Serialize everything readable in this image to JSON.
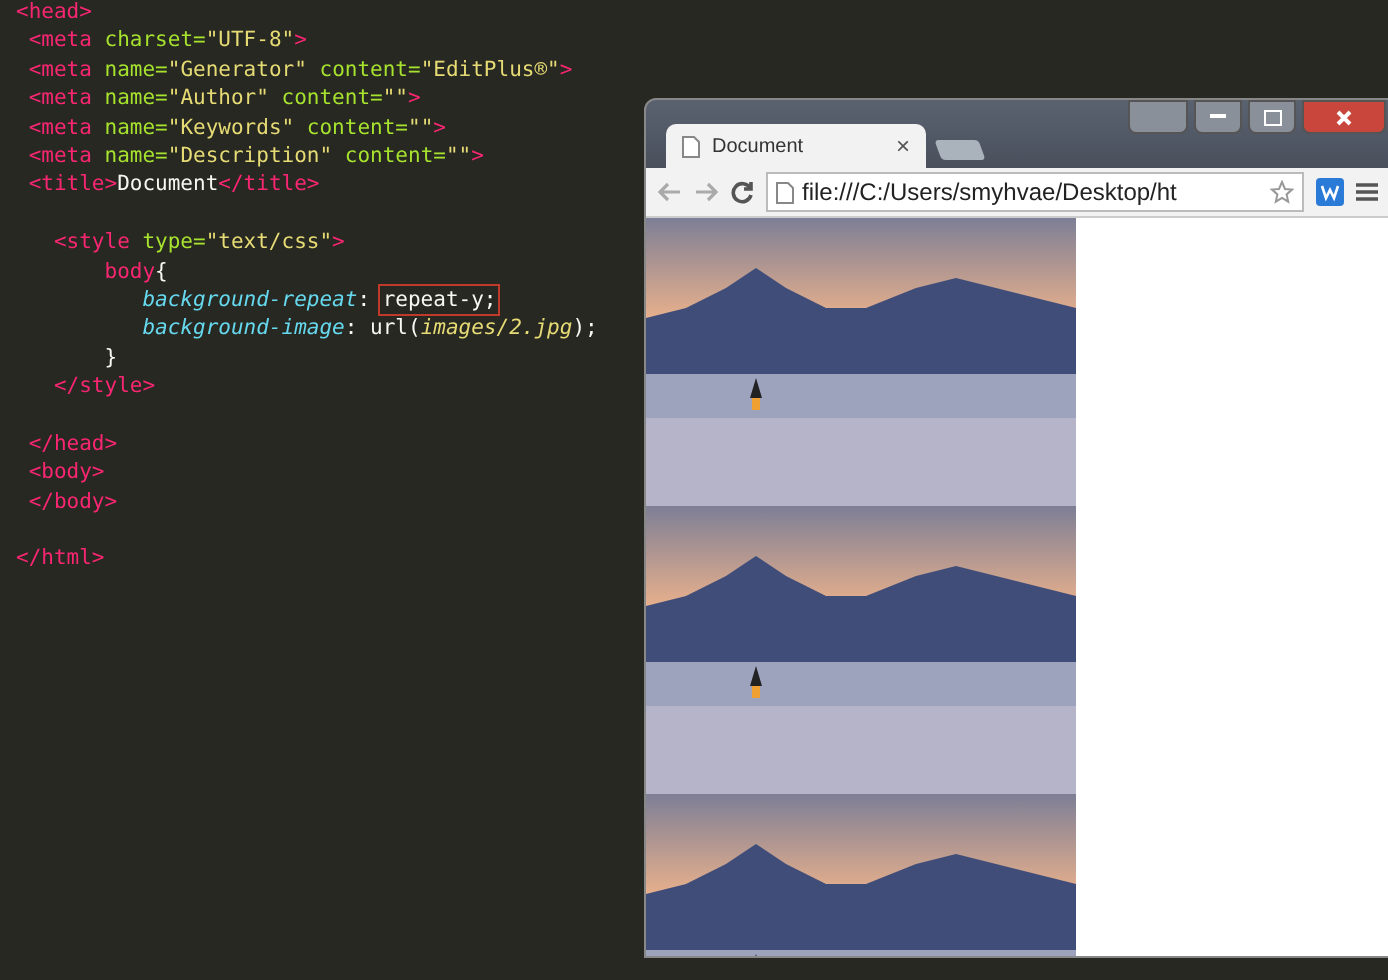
{
  "editor": {
    "lines": [
      {
        "space_after": false,
        "tokens": [
          {
            "kind": "tag",
            "text": "<head>"
          }
        ]
      },
      {
        "space_after": false,
        "tokens": [
          {
            "kind": "tag",
            "text": " <meta "
          },
          {
            "kind": "attr",
            "text": "charset="
          },
          {
            "kind": "string",
            "text": "\"UTF-8\""
          },
          {
            "kind": "tag",
            "text": ">"
          }
        ]
      },
      {
        "space_after": false,
        "tokens": [
          {
            "kind": "tag",
            "text": " <meta "
          },
          {
            "kind": "attr",
            "text": "name="
          },
          {
            "kind": "string",
            "text": "\"Generator\""
          },
          {
            "kind": "attr",
            "text": " content="
          },
          {
            "kind": "string",
            "text": "\"EditPlus®\""
          },
          {
            "kind": "tag",
            "text": ">"
          }
        ]
      },
      {
        "space_after": false,
        "tokens": [
          {
            "kind": "tag",
            "text": " <meta "
          },
          {
            "kind": "attr",
            "text": "name="
          },
          {
            "kind": "string",
            "text": "\"Author\""
          },
          {
            "kind": "attr",
            "text": " content="
          },
          {
            "kind": "string",
            "text": "\"\""
          },
          {
            "kind": "tag",
            "text": ">"
          }
        ]
      },
      {
        "space_after": false,
        "tokens": [
          {
            "kind": "tag",
            "text": " <meta "
          },
          {
            "kind": "attr",
            "text": "name="
          },
          {
            "kind": "string",
            "text": "\"Keywords\""
          },
          {
            "kind": "attr",
            "text": " content="
          },
          {
            "kind": "string",
            "text": "\"\""
          },
          {
            "kind": "tag",
            "text": ">"
          }
        ]
      },
      {
        "space_after": false,
        "tokens": [
          {
            "kind": "tag",
            "text": " <meta "
          },
          {
            "kind": "attr",
            "text": "name="
          },
          {
            "kind": "string",
            "text": "\"Description\""
          },
          {
            "kind": "attr",
            "text": " content="
          },
          {
            "kind": "string",
            "text": "\"\""
          },
          {
            "kind": "tag",
            "text": ">"
          }
        ]
      },
      {
        "space_after": true,
        "tokens": [
          {
            "kind": "tag",
            "text": " <title>"
          },
          {
            "kind": "text",
            "text": "Document"
          },
          {
            "kind": "tag",
            "text": "</title>"
          }
        ]
      },
      {
        "space_after": false,
        "tokens": [
          {
            "kind": "tag",
            "text": "   <style "
          },
          {
            "kind": "attr",
            "text": "type="
          },
          {
            "kind": "string",
            "text": "\"text/css\""
          },
          {
            "kind": "tag",
            "text": ">"
          }
        ]
      },
      {
        "space_after": false,
        "tokens": [
          {
            "kind": "tag",
            "text": "       body"
          },
          {
            "kind": "text",
            "text": "{"
          }
        ]
      },
      {
        "space_after": false,
        "tokens": [
          {
            "kind": "prop",
            "text": "          background-repeat"
          },
          {
            "kind": "text",
            "text": ": "
          },
          {
            "kind": "value",
            "text": "repeat-y;",
            "boxed": true
          }
        ]
      },
      {
        "space_after": false,
        "tokens": [
          {
            "kind": "prop",
            "text": "          background-image"
          },
          {
            "kind": "text",
            "text": ": "
          },
          {
            "kind": "value",
            "text": "url("
          },
          {
            "kind": "path",
            "text": "images/2.jpg"
          },
          {
            "kind": "value",
            "text": ");"
          }
        ]
      },
      {
        "space_after": false,
        "tokens": [
          {
            "kind": "text",
            "text": "       }"
          }
        ]
      },
      {
        "space_after": true,
        "tokens": [
          {
            "kind": "tag",
            "text": "   </style>"
          }
        ]
      },
      {
        "space_after": false,
        "tokens": [
          {
            "kind": "tag",
            "text": " </head>"
          }
        ]
      },
      {
        "space_after": false,
        "tokens": [
          {
            "kind": "tag",
            "text": " <body>"
          }
        ]
      },
      {
        "space_after": true,
        "tokens": [
          {
            "kind": "tag",
            "text": " </body>"
          }
        ]
      },
      {
        "space_after": false,
        "tokens": [
          {
            "kind": "tag",
            "text": "</html>"
          }
        ]
      }
    ]
  },
  "browser": {
    "tab": {
      "title": "Document",
      "close": "×"
    },
    "address": "file:///C:/Users/smyhvae/Desktop/ht"
  }
}
